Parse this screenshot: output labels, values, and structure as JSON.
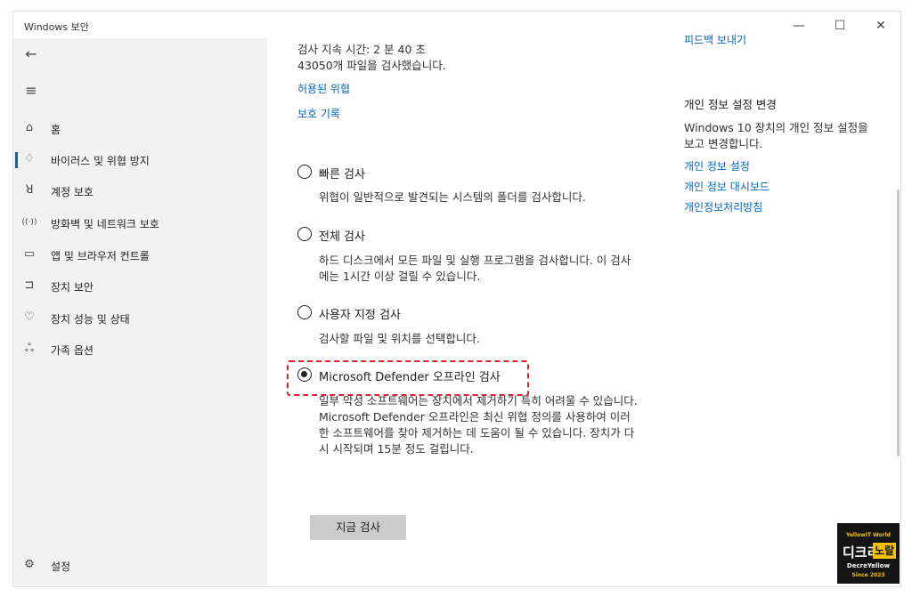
{
  "window": {
    "title": "Windows 보안",
    "controls": {
      "minimize": "—",
      "maximize": "☐",
      "close": "✕"
    }
  },
  "sidebar": {
    "back_icon": "←",
    "menu_icon": "≡",
    "items": [
      {
        "icon": "home-icon",
        "glyph": "⌂",
        "label": "홈"
      },
      {
        "icon": "shield-icon",
        "glyph": "♢",
        "label": "바이러스 및 위협 방지",
        "selected": true
      },
      {
        "icon": "person-icon",
        "glyph": "ꓤ",
        "label": "계정 보호"
      },
      {
        "icon": "wifi-icon",
        "glyph": "((·))",
        "label": "방화벽 및 네트워크 보호"
      },
      {
        "icon": "browser-icon",
        "glyph": "▭",
        "label": "앱 및 브라우저 컨트롤"
      },
      {
        "icon": "laptop-icon",
        "glyph": "⊐",
        "label": "장치 보안"
      },
      {
        "icon": "heart-icon",
        "glyph": "♡",
        "label": "장치 성능 및 상태"
      },
      {
        "icon": "family-icon",
        "glyph": "ஃ",
        "label": "가족 옵션"
      }
    ],
    "settings": {
      "icon": "gear-icon",
      "glyph": "⚙",
      "label": "설정"
    }
  },
  "main": {
    "scan_time": "검사 지속 시간: 2 분 40 초",
    "files_scanned": "43050개 파일을 검사했습니다.",
    "links": {
      "allowed_threats": "허용된 위협",
      "protection_history": "보호 기록"
    },
    "options": [
      {
        "label": "빠른 검사",
        "desc": "위협이 일반적으로 발견되는 시스템의 폴더를 검사합니다.",
        "selected": false
      },
      {
        "label": "전체 검사",
        "desc": "하드 디스크에서 모든 파일 및 실행 프로그램을 검사합니다. 이 검사에는 1시간 이상 걸릴 수 있습니다.",
        "selected": false
      },
      {
        "label": "사용자 지정 검사",
        "desc": "검사할 파일 및 위치를 선택합니다.",
        "selected": false
      },
      {
        "label": "Microsoft Defender 오프라인 검사",
        "desc": "일부 악성 소프트웨어는 장치에서 제거하기 특히 어려울 수 있습니다. Microsoft Defender 오프라인은 최신 위협 정의를 사용하여 이러한 소프트웨어를 찾아 제거하는 데 도움이 될 수 있습니다. 장치가 다시 시작되며 15분 정도 걸립니다.",
        "selected": true
      }
    ],
    "scan_button": "지금 검사"
  },
  "right_pane": {
    "cut_link": "피드백 보내기",
    "privacy_title": "개인 정보 설정 변경",
    "privacy_desc": "Windows 10 장치의 개인 정보 설정을 보고 변경합니다.",
    "links": [
      "개인 정보 설정",
      "개인 정보 대시보드",
      "개인정보처리방침"
    ]
  },
  "watermark": {
    "top": "YellowIT World",
    "main_left": "디크리",
    "main_right": "노랄",
    "brand": "DecreYellow",
    "since": "Since 2023"
  },
  "colors": {
    "accent": "#0067c0",
    "sidebar_bg": "#f2f2f2",
    "highlight": "#d7262e",
    "button_bg": "#cccccc"
  }
}
